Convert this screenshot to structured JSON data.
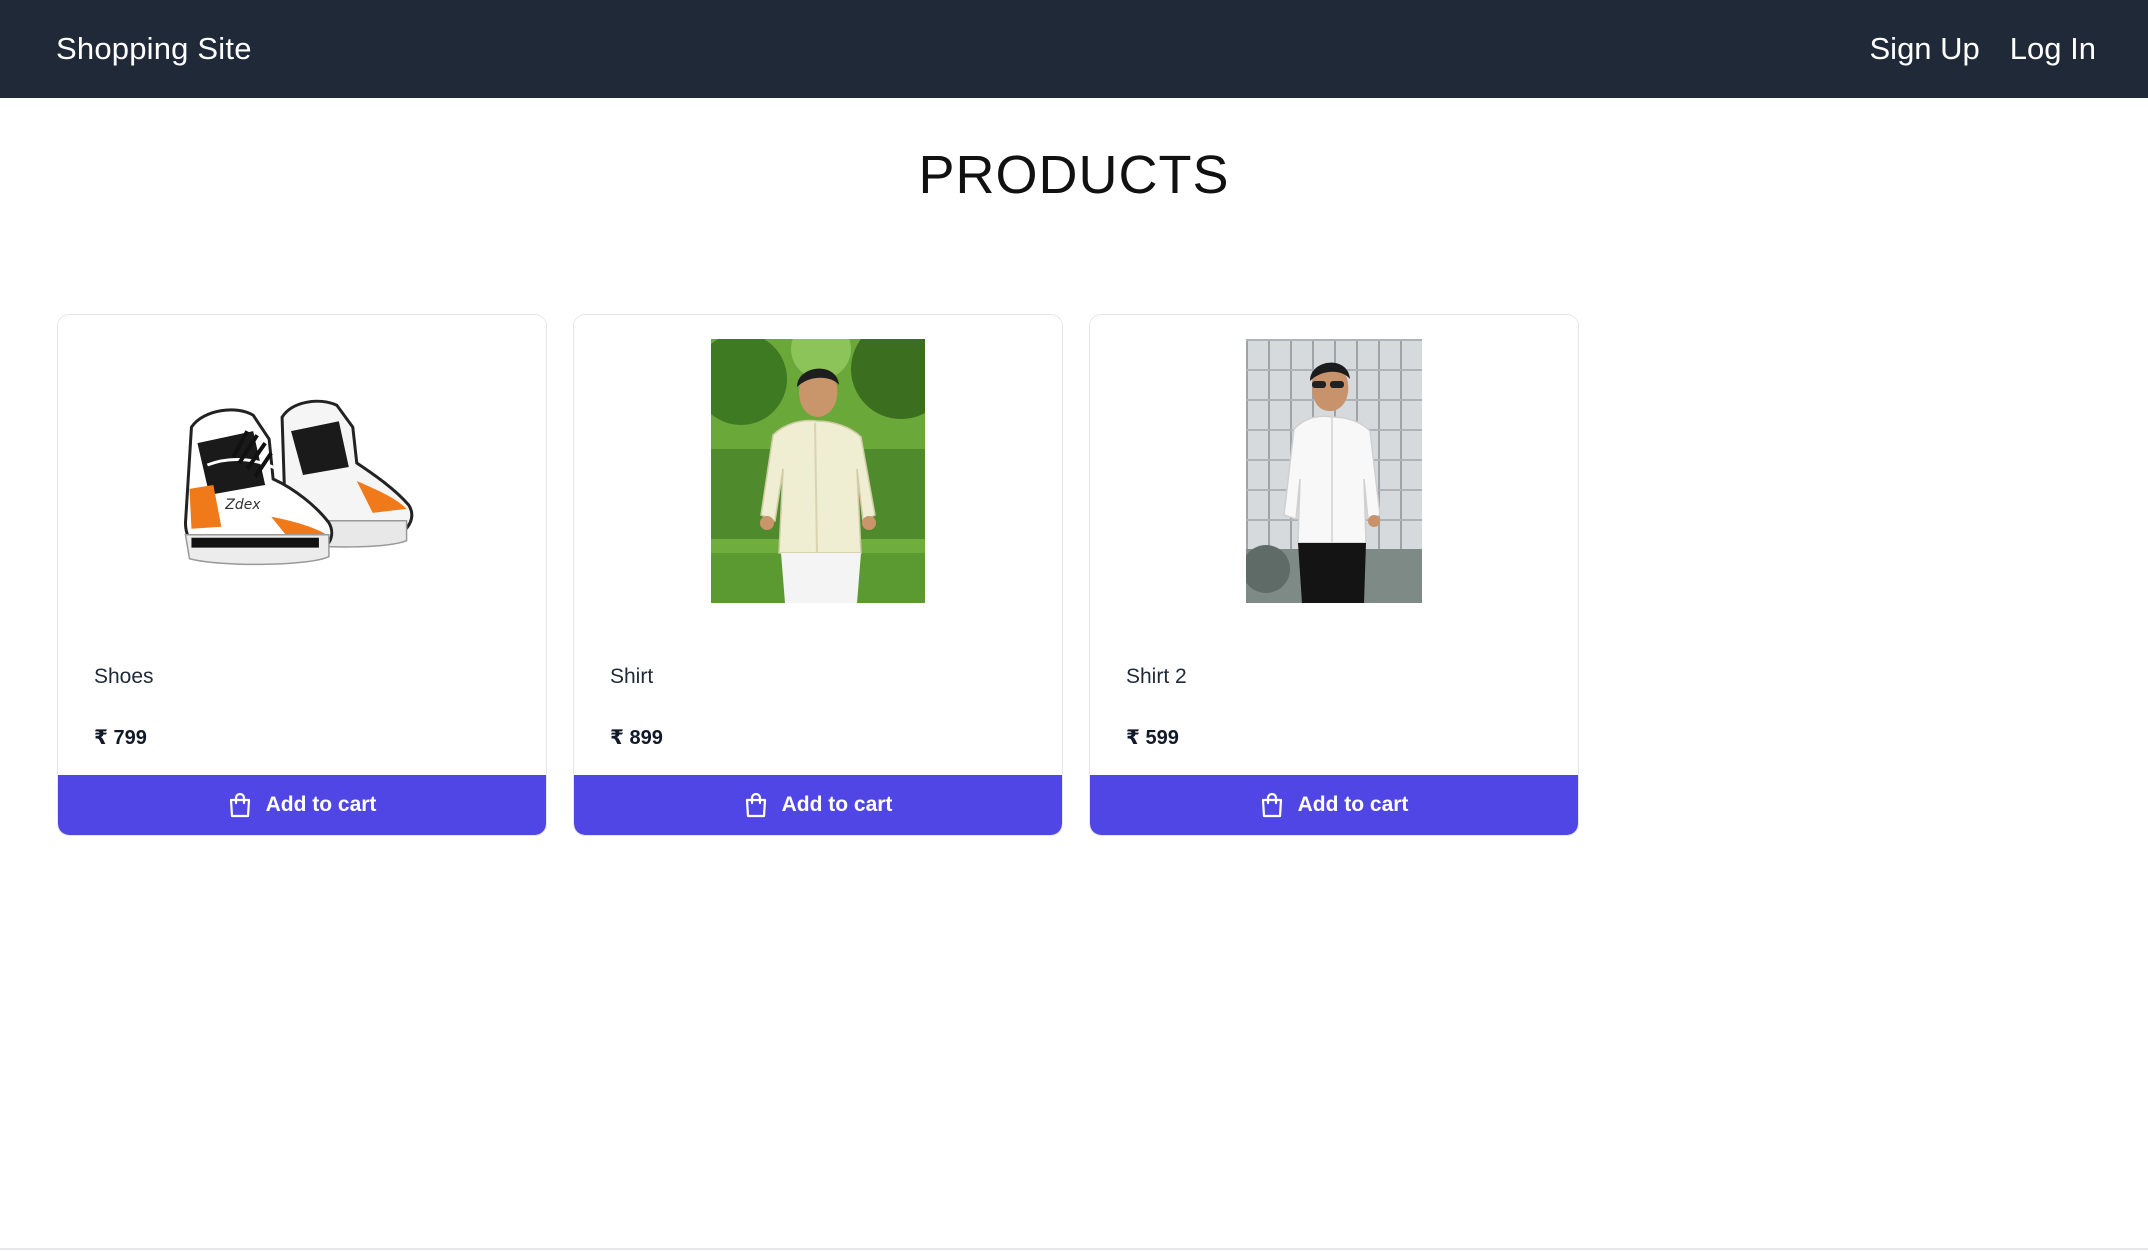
{
  "header": {
    "brand": "Shopping Site",
    "links": [
      {
        "label": "Sign Up"
      },
      {
        "label": "Log In"
      }
    ]
  },
  "main": {
    "title": "PRODUCTS"
  },
  "products": [
    {
      "name": "Shoes",
      "price": "₹ 799",
      "cart_label": "Add to cart",
      "image": "sneakers-photo"
    },
    {
      "name": "Shirt",
      "price": "₹ 899",
      "cart_label": "Add to cart",
      "image": "man-in-cream-shirt-photo"
    },
    {
      "name": "Shirt 2",
      "price": "₹ 599",
      "cart_label": "Add to cart",
      "image": "man-in-white-shirt-photo"
    }
  ],
  "colors": {
    "navbar": "#1f2937",
    "button": "#4f46e5",
    "card_border": "#e5e7eb"
  },
  "icons": {
    "cart_button": "shopping-bag-icon"
  }
}
